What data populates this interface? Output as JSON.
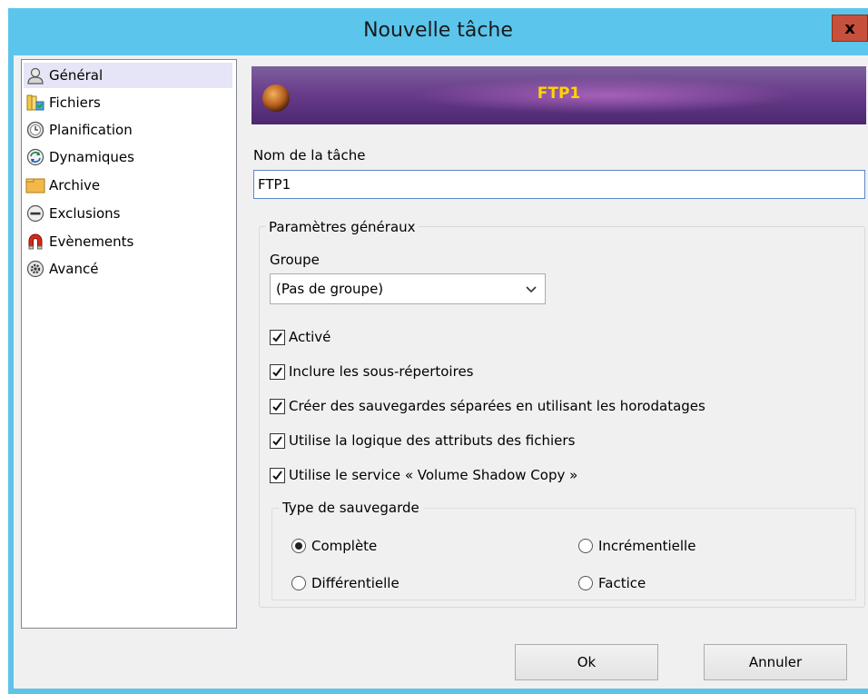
{
  "window": {
    "title": "Nouvelle tâche",
    "close_label": "x"
  },
  "sidebar": {
    "items": [
      {
        "label": "Général",
        "icon": "user-icon",
        "selected": true
      },
      {
        "label": "Fichiers",
        "icon": "files-icon",
        "selected": false
      },
      {
        "label": "Planification",
        "icon": "clock-icon",
        "selected": false
      },
      {
        "label": "Dynamiques",
        "icon": "sync-icon",
        "selected": false
      },
      {
        "label": "Archive",
        "icon": "folder-icon",
        "selected": false
      },
      {
        "label": "Exclusions",
        "icon": "minus-circle-icon",
        "selected": false
      },
      {
        "label": "Evènements",
        "icon": "magnet-icon",
        "selected": false
      },
      {
        "label": "Avancé",
        "icon": "gear-icon",
        "selected": false
      }
    ]
  },
  "banner": {
    "title": "FTP1"
  },
  "task_name": {
    "label": "Nom de la tâche",
    "value": "FTP1"
  },
  "general": {
    "legend": "Paramètres généraux",
    "group_label": "Groupe",
    "group_value": "(Pas de groupe)",
    "checkboxes": [
      {
        "label": "Activé",
        "checked": true
      },
      {
        "label": "Inclure les sous-répertoires",
        "checked": true
      },
      {
        "label": "Créer des sauvegardes séparées en utilisant les horodatages",
        "checked": true
      },
      {
        "label": "Utilise la logique des attributs des fichiers",
        "checked": true
      },
      {
        "label": "Utilise le service « Volume Shadow Copy »",
        "checked": true
      }
    ]
  },
  "backup_type": {
    "legend": "Type de sauvegarde",
    "options": [
      {
        "label": "Complète",
        "selected": true
      },
      {
        "label": "Incrémentielle",
        "selected": false
      },
      {
        "label": "Différentielle",
        "selected": false
      },
      {
        "label": "Factice",
        "selected": false
      }
    ]
  },
  "buttons": {
    "ok": "Ok",
    "cancel": "Annuler"
  },
  "colors": {
    "titlebar": "#5cc5ec",
    "banner": "#6a3d8a",
    "banner_text": "#ffd400",
    "close": "#c7503c"
  }
}
